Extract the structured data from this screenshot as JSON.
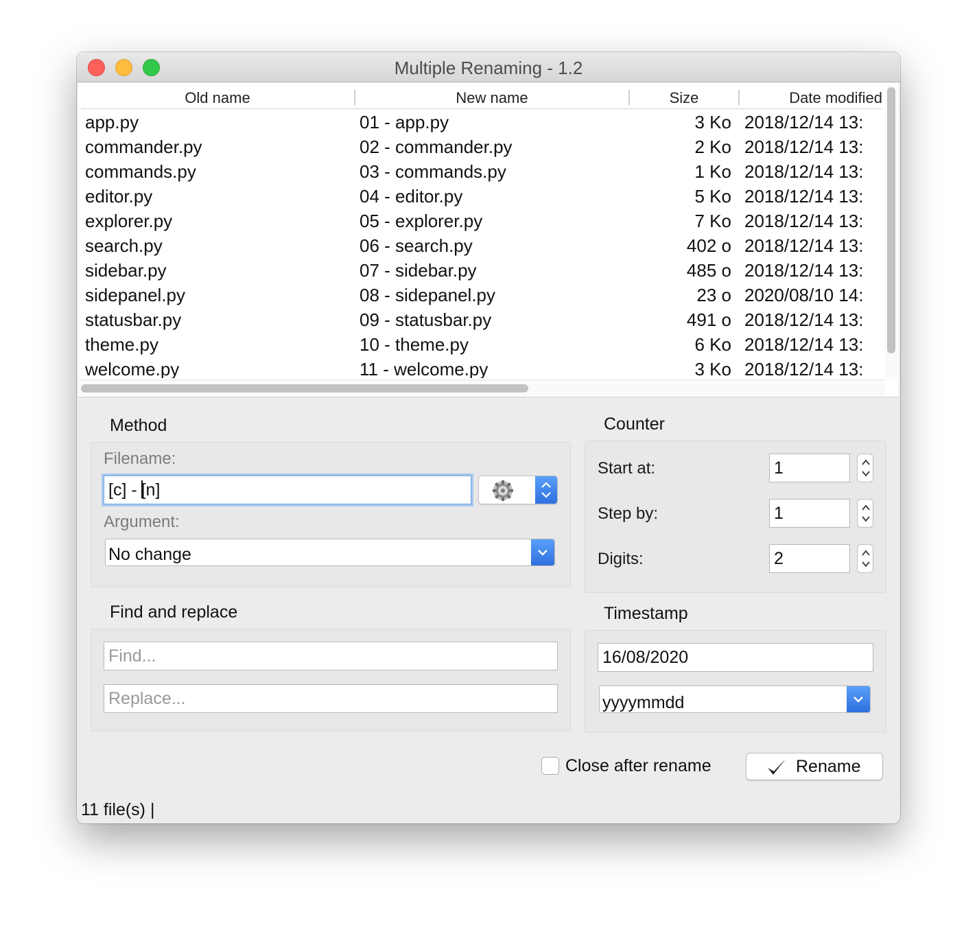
{
  "window": {
    "title": "Multiple Renaming - 1.2"
  },
  "table": {
    "columns": [
      "Old name",
      "New name",
      "Size",
      "Date modified"
    ],
    "rows": [
      {
        "old": "app.py",
        "new": "01 - app.py",
        "size": "3 Ko",
        "date": "2018/12/14 13:"
      },
      {
        "old": "commander.py",
        "new": "02 - commander.py",
        "size": "2 Ko",
        "date": "2018/12/14 13:"
      },
      {
        "old": "commands.py",
        "new": "03 - commands.py",
        "size": "1 Ko",
        "date": "2018/12/14 13:"
      },
      {
        "old": "editor.py",
        "new": "04 - editor.py",
        "size": "5 Ko",
        "date": "2018/12/14 13:"
      },
      {
        "old": "explorer.py",
        "new": "05 - explorer.py",
        "size": "7 Ko",
        "date": "2018/12/14 13:"
      },
      {
        "old": "search.py",
        "new": "06 - search.py",
        "size": "402 o",
        "date": "2018/12/14 13:"
      },
      {
        "old": "sidebar.py",
        "new": "07 - sidebar.py",
        "size": "485 o",
        "date": "2018/12/14 13:"
      },
      {
        "old": "sidepanel.py",
        "new": "08 - sidepanel.py",
        "size": "23 o",
        "date": "2020/08/10 14:"
      },
      {
        "old": "statusbar.py",
        "new": "09 - statusbar.py",
        "size": "491 o",
        "date": "2018/12/14 13:"
      },
      {
        "old": "theme.py",
        "new": "10 - theme.py",
        "size": "6 Ko",
        "date": "2018/12/14 13:"
      },
      {
        "old": "welcome.py",
        "new": "11 - welcome.py",
        "size": "3 Ko",
        "date": "2018/12/14 13:"
      }
    ]
  },
  "method": {
    "title": "Method",
    "filename_label": "Filename:",
    "filename_before_caret": "[c] - ",
    "filename_after_caret": "[n]",
    "argument_label": "Argument:",
    "argument_value": "No change"
  },
  "counter": {
    "title": "Counter",
    "start_label": "Start at:",
    "start_value": "1",
    "step_label": "Step by:",
    "step_value": "1",
    "digits_label": "Digits:",
    "digits_value": "2"
  },
  "find_replace": {
    "title": "Find and replace",
    "find_placeholder": "Find...",
    "replace_placeholder": "Replace..."
  },
  "timestamp": {
    "title": "Timestamp",
    "date_value": "16/08/2020",
    "format_value": "yyyymmdd"
  },
  "actions": {
    "close_after_rename_label": "Close after rename",
    "close_after_rename_checked": false,
    "rename_label": "Rename"
  },
  "status": {
    "text": "11 file(s) |"
  },
  "colors": {
    "accent": "#3a7ee9",
    "focus_ring": "#a9c9ee",
    "window_bg": "#ececec"
  },
  "icons": {
    "gear": "gear-icon",
    "checkmark": "checkmark-icon"
  }
}
